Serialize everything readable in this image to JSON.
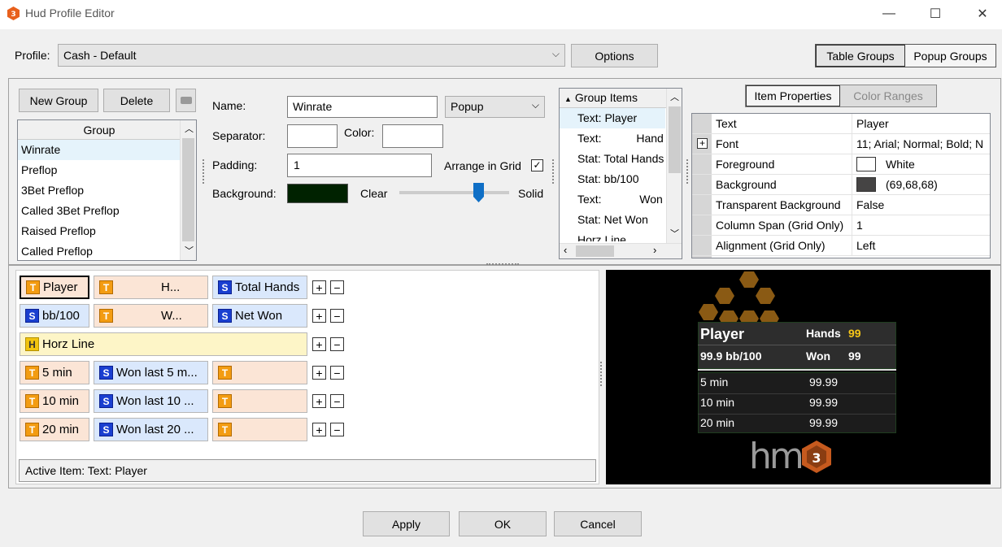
{
  "window": {
    "title": "Hud Profile Editor",
    "minimize": "—",
    "maximize": "☐",
    "close": "✕"
  },
  "profile": {
    "label": "Profile:",
    "value": "Cash - Default",
    "options_button": "Options"
  },
  "top_tabs": {
    "table_groups": "Table Groups",
    "popup_groups": "Popup Groups"
  },
  "groups_panel": {
    "new_group": "New Group",
    "delete": "Delete",
    "column_header": "Group",
    "items": [
      "Winrate",
      "Preflop",
      "3Bet Preflop",
      "Called 3Bet Preflop",
      "Raised Preflop",
      "Called Preflop"
    ],
    "selected_index": 0
  },
  "group_form": {
    "name_label": "Name:",
    "name_value": "Winrate",
    "type_value": "Popup",
    "separator_label": "Separator:",
    "color_label": "Color:",
    "padding_label": "Padding:",
    "padding_value": "1",
    "arrange_label": "Arrange in Grid",
    "arrange_checked": true,
    "background_label": "Background:",
    "background_color": "#002200",
    "clear_label": "Clear",
    "solid_label": "Solid",
    "opacity": 0.72
  },
  "group_items": {
    "header": "Group Items",
    "items": [
      "Text: Player",
      "Text:           Hand",
      "Stat: Total Hands",
      "Stat: bb/100",
      "Text:            Won",
      "Stat: Net Won",
      "Horz Line"
    ]
  },
  "item_props": {
    "tab_properties": "Item Properties",
    "tab_color_ranges": "Color Ranges",
    "rows": [
      {
        "name": "Text",
        "value": "Player"
      },
      {
        "name": "Font",
        "value": "11; Arial; Normal; Bold; N",
        "expand": "+"
      },
      {
        "name": "Foreground",
        "value": "White",
        "swatch": "#ffffff"
      },
      {
        "name": "Background",
        "value": "(69,68,68)",
        "swatch": "#454444"
      },
      {
        "name": "Transparent Background",
        "value": "False"
      },
      {
        "name": "Column Span (Grid Only)",
        "value": "1"
      },
      {
        "name": "Alignment (Grid Only)",
        "value": "Left"
      }
    ]
  },
  "layout_grid": {
    "rows": [
      [
        {
          "type": "t",
          "badge": "T",
          "text": "Player",
          "active": true
        },
        {
          "type": "t",
          "badge": "T",
          "text": "H..."
        },
        {
          "type": "s",
          "badge": "S",
          "text": "Total Hands"
        }
      ],
      [
        {
          "type": "s",
          "badge": "S",
          "text": "bb/100"
        },
        {
          "type": "t",
          "badge": "T",
          "text": "W..."
        },
        {
          "type": "s",
          "badge": "S",
          "text": "Net Won"
        }
      ],
      [
        {
          "type": "h",
          "badge": "H",
          "text": "Horz Line"
        }
      ],
      [
        {
          "type": "t",
          "badge": "T",
          "text": "5 min"
        },
        {
          "type": "s",
          "badge": "S",
          "text": "Won last 5 m..."
        },
        {
          "type": "t",
          "badge": "T",
          "text": ""
        }
      ],
      [
        {
          "type": "t",
          "badge": "T",
          "text": "10 min"
        },
        {
          "type": "s",
          "badge": "S",
          "text": "Won last 10 ..."
        },
        {
          "type": "t",
          "badge": "T",
          "text": ""
        }
      ],
      [
        {
          "type": "t",
          "badge": "T",
          "text": "20 min"
        },
        {
          "type": "s",
          "badge": "S",
          "text": "Won last 20 ..."
        },
        {
          "type": "t",
          "badge": "T",
          "text": ""
        }
      ]
    ],
    "plus": "+",
    "minus": "−",
    "active_item": "Active Item: Text: Player"
  },
  "preview": {
    "player": "Player",
    "hands_label": "Hands",
    "hands_value": "99",
    "bb100": "99.9 bb/100",
    "won_label": "Won",
    "won_value": "99",
    "rows": [
      {
        "label": "5 min",
        "value": "99.99"
      },
      {
        "label": "10 min",
        "value": "99.99"
      },
      {
        "label": "20 min",
        "value": "99.99"
      }
    ],
    "logo_text": "hm",
    "logo_num": "3"
  },
  "footer": {
    "apply": "Apply",
    "ok": "OK",
    "cancel": "Cancel"
  }
}
